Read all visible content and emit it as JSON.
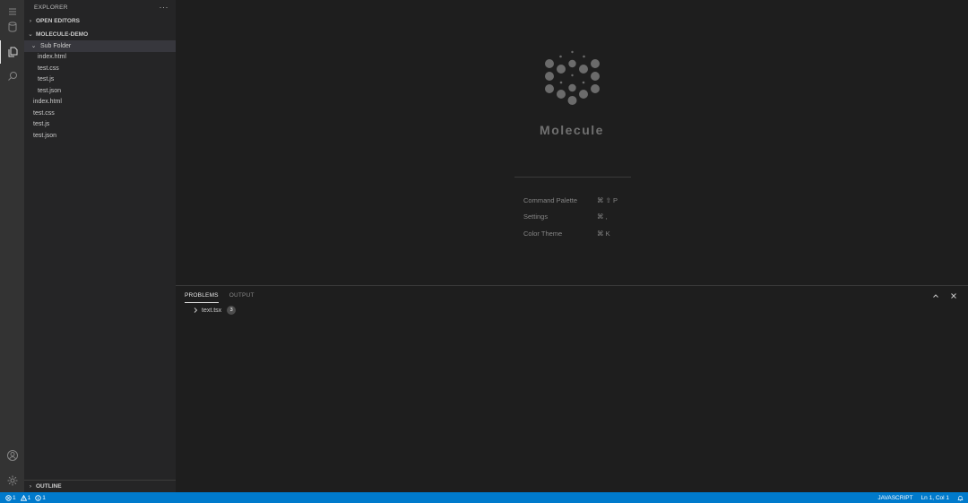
{
  "activity_bar": {
    "items": [
      {
        "icon": "menu-icon"
      },
      {
        "icon": "database-icon"
      },
      {
        "icon": "files-icon",
        "active": true
      },
      {
        "icon": "search-icon"
      },
      {
        "icon": "account-icon"
      },
      {
        "icon": "gear-icon"
      }
    ]
  },
  "sidebar": {
    "title": "EXPLORER",
    "more_label": "···",
    "open_editors": "OPEN EDITORS",
    "project": "MOLECULE-DEMO",
    "tree": [
      {
        "label": "Sub Folder",
        "folder": true,
        "selected": true
      },
      {
        "label": "index.html",
        "child": true
      },
      {
        "label": "test.css",
        "child": true
      },
      {
        "label": "test.js",
        "child": true
      },
      {
        "label": "test.json",
        "child": true
      },
      {
        "label": "index.html"
      },
      {
        "label": "test.css"
      },
      {
        "label": "test.js"
      },
      {
        "label": "test.json"
      }
    ],
    "outline": "OUTLINE"
  },
  "editor": {
    "brand": "Molecule",
    "shortcuts": [
      {
        "label": "Command Palette",
        "keys": "⌘ ⇧ P"
      },
      {
        "label": "Settings",
        "keys": "⌘ ,"
      },
      {
        "label": "Color Theme",
        "keys": "⌘ K"
      }
    ]
  },
  "panel": {
    "tabs": [
      {
        "label": "PROBLEMS",
        "active": true
      },
      {
        "label": "OUTPUT"
      }
    ],
    "problems": [
      {
        "file": "text.tsx",
        "count": "3"
      }
    ]
  },
  "status_bar": {
    "errors": "1",
    "warnings": "1",
    "infos": "1",
    "language": "JAVASCRIPT",
    "cursor": "Ln 1, Col 1"
  },
  "colors": {
    "accent": "#007acc",
    "activity_bar": "#333333",
    "sidebar": "#252526",
    "editor": "#1e1e1e",
    "logo": "#6b6b6b"
  }
}
